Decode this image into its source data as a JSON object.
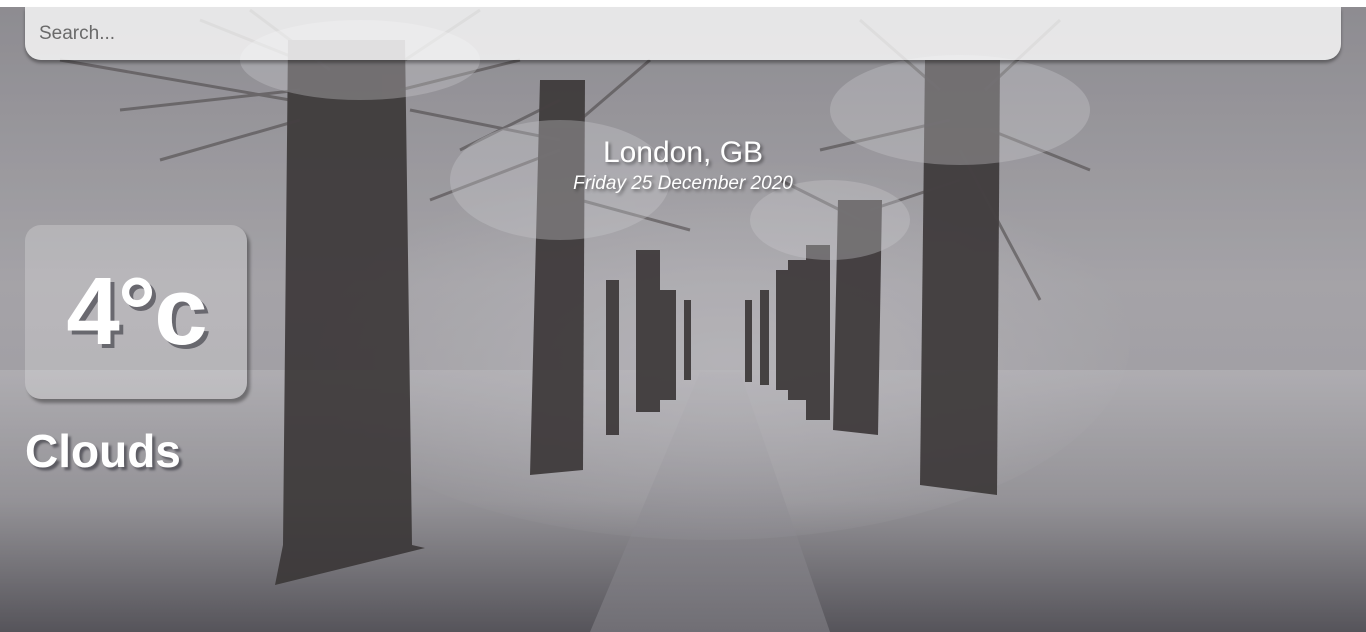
{
  "search": {
    "placeholder": "Search...",
    "value": ""
  },
  "location": {
    "city_country": "London, GB",
    "date": "Friday 25 December 2020"
  },
  "weather": {
    "temperature": "4°c",
    "condition": "Clouds"
  },
  "background": {
    "description_icon": "snowy-tree-avenue-image",
    "colors": {
      "sky": "#b3b1b4",
      "ground": "#6e6c70",
      "trunk": "#3a3533"
    }
  }
}
